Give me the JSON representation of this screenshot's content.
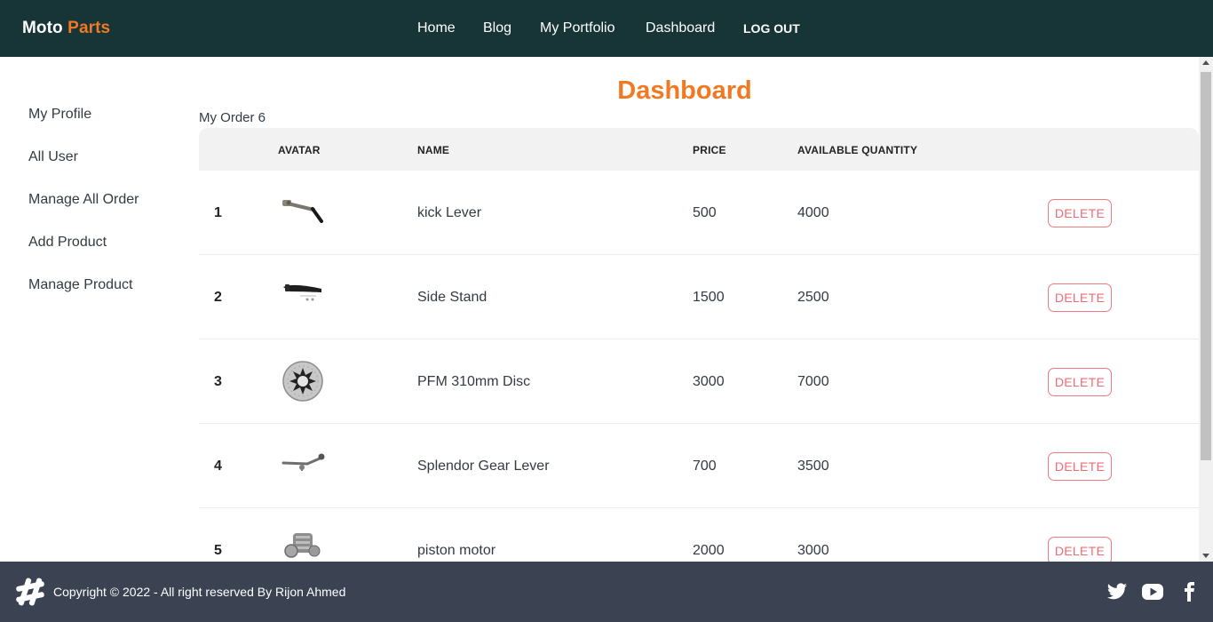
{
  "brand": {
    "part1": "Moto",
    "part2": "Parts"
  },
  "nav": {
    "home": "Home",
    "blog": "Blog",
    "portfolio": "My Portfolio",
    "dashboard": "Dashboard",
    "logout": "LOG OUT"
  },
  "sidebar": {
    "items": [
      {
        "label": "My Profile"
      },
      {
        "label": "All User"
      },
      {
        "label": "Manage All Order"
      },
      {
        "label": "Add Product"
      },
      {
        "label": "Manage Product"
      }
    ]
  },
  "main": {
    "title": "Dashboard",
    "order_count": "My Order 6"
  },
  "table": {
    "headers": {
      "avatar": "AVATAR",
      "name": "NAME",
      "price": "PRICE",
      "quantity": "AVAILABLE QUANTITY"
    },
    "delete_label": "DELETE",
    "rows": [
      {
        "index": "1",
        "name": "kick Lever",
        "price": "500",
        "quantity": "4000",
        "avatar_icon": "kick-lever-image"
      },
      {
        "index": "2",
        "name": "Side Stand",
        "price": "1500",
        "quantity": "2500",
        "avatar_icon": "side-stand-image"
      },
      {
        "index": "3",
        "name": "PFM 310mm Disc",
        "price": "3000",
        "quantity": "7000",
        "avatar_icon": "brake-disc-image"
      },
      {
        "index": "4",
        "name": "Splendor Gear Lever",
        "price": "700",
        "quantity": "3500",
        "avatar_icon": "gear-lever-image"
      },
      {
        "index": "5",
        "name": "piston motor",
        "price": "2000",
        "quantity": "3000",
        "avatar_icon": "piston-motor-image"
      }
    ]
  },
  "footer": {
    "copyright": "Copyright © 2022 - All right reserved By Rijon Ahmed",
    "logo_icon": "hash-logo-icon",
    "social": [
      "twitter-icon",
      "youtube-icon",
      "facebook-icon"
    ]
  },
  "colors": {
    "navbar_bg": "#173436",
    "accent": "#f07a23",
    "footer_bg": "#3b4252",
    "delete": "#f06b74"
  }
}
